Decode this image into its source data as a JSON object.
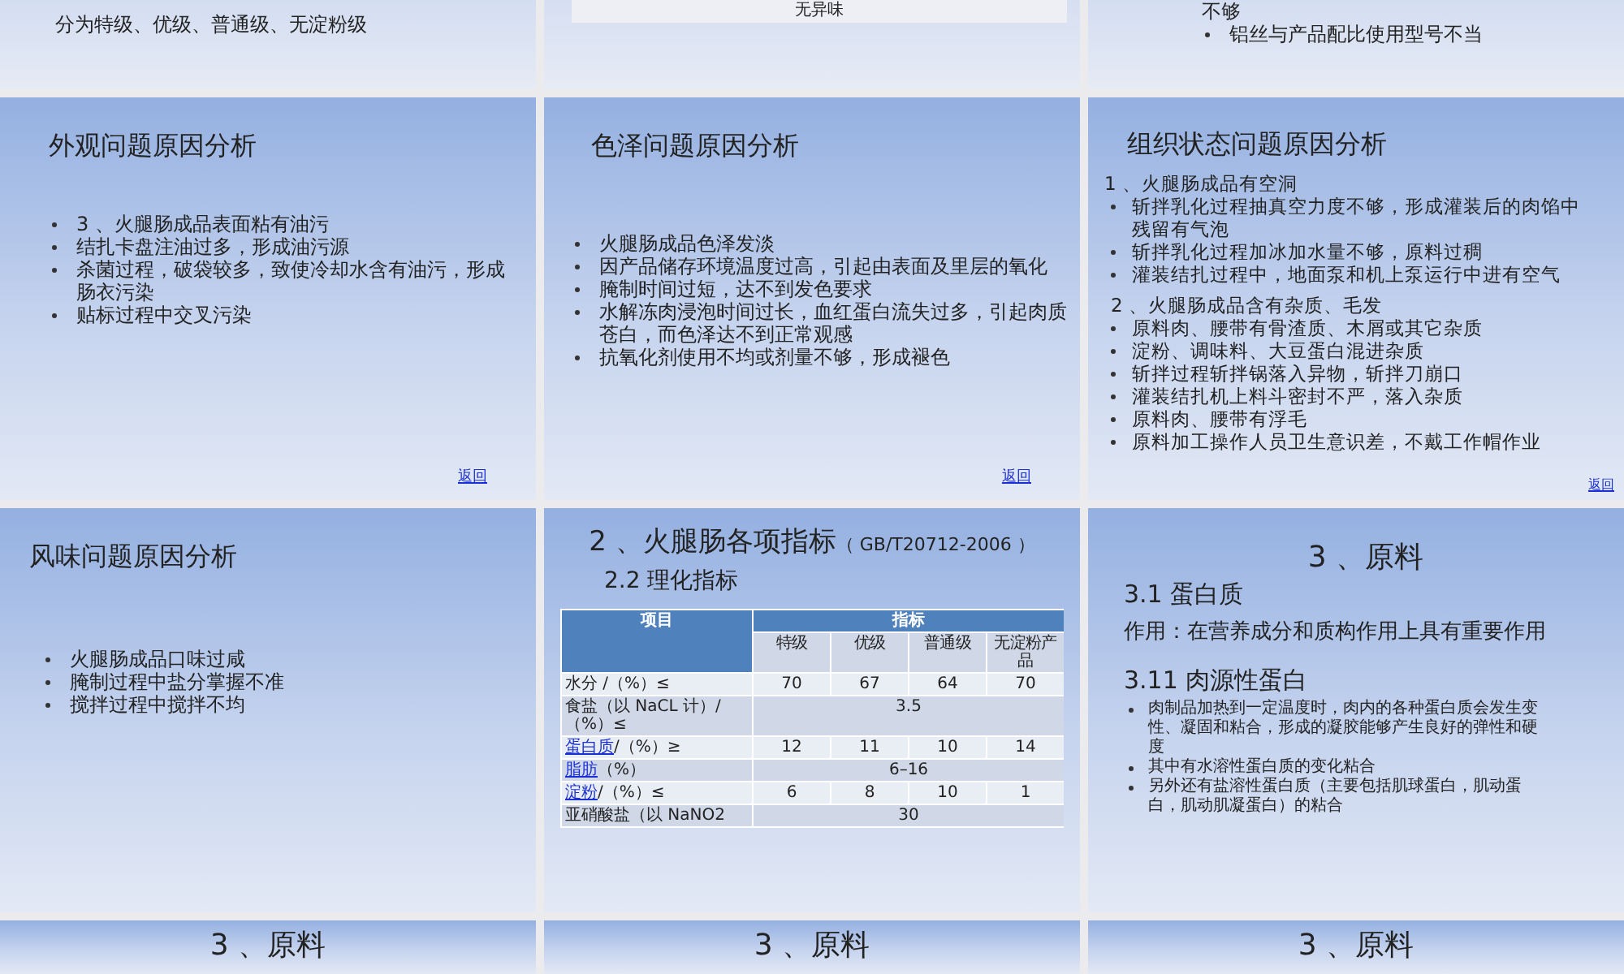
{
  "slides": [
    {
      "kind": "fragment",
      "items": [
        {
          "kind": "plain",
          "text": "分为特级、优级、普通级、无淀粉级"
        }
      ]
    },
    {
      "kind": "cell-fragment",
      "cell": "无异味"
    },
    {
      "kind": "fragment",
      "items": [
        {
          "kind": "plain",
          "text": "不够"
        },
        {
          "kind": "bullet",
          "text": "铝丝与产品配比使用型号不当"
        }
      ]
    },
    {
      "kind": "analysis",
      "title": "外观问题原因分析",
      "items": [
        {
          "kind": "bullet",
          "text": "3 、火腿肠成品表面粘有油污"
        },
        {
          "kind": "bullet",
          "text": "结扎卡盘注油过多，形成油污源"
        },
        {
          "kind": "bullet",
          "text": "杀菌过程，破袋较多，致使冷却水含有油污，形成肠衣污染"
        },
        {
          "kind": "bullet",
          "text": "贴标过程中交叉污染"
        }
      ],
      "link": "返回"
    },
    {
      "kind": "analysis",
      "title": "色泽问题原因分析",
      "items": [
        {
          "kind": "bullet",
          "text": "火腿肠成品色泽发淡"
        },
        {
          "kind": "bullet",
          "text": "因产品储存环境温度过高，引起由表面及里层的氧化"
        },
        {
          "kind": "bullet",
          "text": "腌制时间过短，达不到发色要求"
        },
        {
          "kind": "bullet",
          "text": "水解冻肉浸泡时间过长，血红蛋白流失过多，引起肉质苍白，而色泽达不到正常观感"
        },
        {
          "kind": "bullet",
          "text": "抗氧化剂使用不均或剂量不够，形成褪色"
        }
      ],
      "link": "返回"
    },
    {
      "kind": "outline",
      "title": "组织状态问题原因分析",
      "items": [
        {
          "kind": "plain",
          "text": "1 、火腿肠成品有空洞"
        },
        {
          "kind": "bullet",
          "text": "斩拌乳化过程抽真空力度不够，形成灌装后的肉馅中残留有气泡"
        },
        {
          "kind": "bullet",
          "text": "斩拌乳化过程加冰加水量不够，原料过稠"
        },
        {
          "kind": "bullet",
          "text": "灌装结扎过程中，地面泵和机上泵运行中进有空气"
        },
        {
          "kind": "plain",
          "text": "2 、火腿肠成品含有杂质、毛发"
        },
        {
          "kind": "bullet",
          "text": "原料肉、腰带有骨渣质、木屑或其它杂质"
        },
        {
          "kind": "bullet",
          "text": "淀粉、调味料、大豆蛋白混进杂质"
        },
        {
          "kind": "bullet",
          "text": "斩拌过程斩拌锅落入异物，斩拌刀崩口"
        },
        {
          "kind": "bullet",
          "text": "灌装结扎机上料斗密封不严，落入杂质"
        },
        {
          "kind": "bullet",
          "text": "原料肉、腰带有浮毛"
        },
        {
          "kind": "bullet",
          "text": "原料加工操作人员卫生意识差，不戴工作帽作业"
        }
      ],
      "link": "返回"
    },
    {
      "kind": "analysis",
      "title": "风味问题原因分析",
      "items": [
        {
          "kind": "bullet",
          "text": "火腿肠成品口味过咸"
        },
        {
          "kind": "bullet",
          "text": "腌制过程中盐分掌握不准"
        },
        {
          "kind": "bullet",
          "text": "搅拌过程中搅拌不均"
        }
      ]
    },
    {
      "kind": "table",
      "title": "2 、火腿肠各项指标",
      "title_note": "（ GB/T20712-2006 ）",
      "heading": "2.2 理化指标",
      "table": {
        "item": "项目",
        "group": "指标",
        "grades": [
          "特级",
          "优级",
          "普通级",
          "无淀粉产品"
        ],
        "rows": [
          {
            "label": "水分 /（%）≤",
            "values": [
              "70",
              "67",
              "64",
              "70"
            ]
          },
          {
            "label": "食盐（以 NaCL 计）/（%）≤",
            "values": [
              "3.5"
            ]
          },
          {
            "link": "蛋白质",
            "label": "/（%）≥",
            "values": [
              "12",
              "11",
              "10",
              "14"
            ]
          },
          {
            "link": "脂肪",
            "label": "（%）",
            "values": [
              "6–16"
            ]
          },
          {
            "link": "淀粉",
            "label": "/（%）≤",
            "values": [
              "6",
              "8",
              "10",
              "1"
            ]
          },
          {
            "label": "亚硝酸盐（以 NaNO2",
            "values": [
              "30"
            ]
          }
        ]
      }
    },
    {
      "kind": "section",
      "title": "3 、原料",
      "heading": "3.1 蛋白质",
      "lead": "作用：在营养成分和质构作用上具有重要作用",
      "subheading": "3.11 肉源性蛋白",
      "items": [
        {
          "kind": "bullet",
          "text": "肉制品加热到一定温度时，肉内的各种蛋白质会发生变性、凝固和粘合，形成的凝胶能够产生良好的弹性和硬度"
        },
        {
          "kind": "bullet",
          "text": "其中有水溶性蛋白质的变化粘合"
        },
        {
          "kind": "bullet",
          "text": "另外还有盐溶性蛋白质（主要包括肌球蛋白，肌动蛋白，肌动肌凝蛋白）的粘合"
        }
      ]
    },
    {
      "kind": "title-fragment",
      "title": "3 、原料"
    },
    {
      "kind": "title-fragment",
      "title": "3 、原料"
    },
    {
      "kind": "title-fragment",
      "title": "3 、原料"
    }
  ]
}
